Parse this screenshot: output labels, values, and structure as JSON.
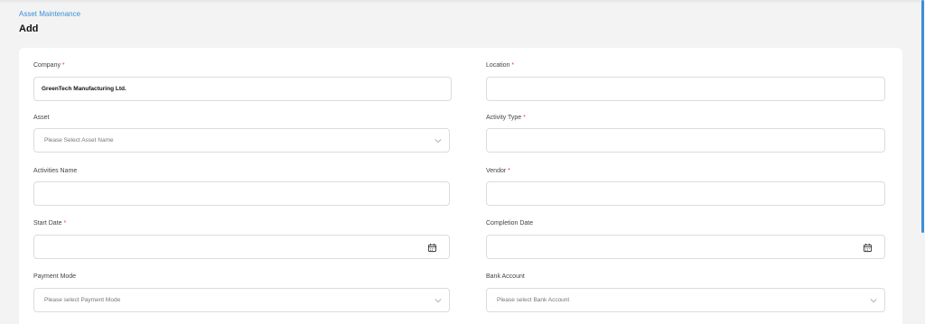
{
  "breadcrumb": "Asset Maintenance",
  "page_title": "Add",
  "required_marker": "*",
  "fields": {
    "company": {
      "label": "Company",
      "value": "GreenTech Manufacturing Ltd."
    },
    "location": {
      "label": "Location",
      "value": ""
    },
    "asset": {
      "label": "Asset",
      "placeholder": "Please Select Asset Name"
    },
    "activity_type": {
      "label": "Activity Type",
      "value": ""
    },
    "activities_name": {
      "label": "Activities Name",
      "value": ""
    },
    "vendor": {
      "label": "Vendor",
      "value": ""
    },
    "start_date": {
      "label": "Start Date",
      "value": ""
    },
    "completion_date": {
      "label": "Completion Date",
      "value": ""
    },
    "payment_mode": {
      "label": "Payment Mode",
      "placeholder": "Please select Payment Mode"
    },
    "bank_account": {
      "label": "Bank Account",
      "placeholder": "Please select Bank Account"
    }
  },
  "colors": {
    "accent": "#3a8fd9",
    "required": "#e04848",
    "background": "#f3f3f3"
  },
  "icons": {
    "dropdown": "chevron-down-icon",
    "date": "calendar-icon"
  }
}
